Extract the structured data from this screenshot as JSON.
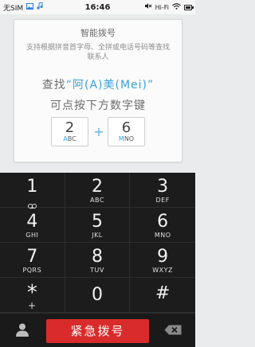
{
  "status_bar": {
    "carrier": "无SIM",
    "time": "16:46",
    "wifi_label": "Hi-Fi",
    "icons": [
      "image-icon",
      "music-icon",
      "mute-icon",
      "wifi-icon",
      "battery-icon"
    ]
  },
  "hint_card": {
    "title": "智能拨号",
    "description": "支持根据拼音首字母、全拼或电话号码等查找联系人",
    "example_prefix": "查找",
    "example_quote_open": "“",
    "example_name": "阿(A)美(Mei)",
    "example_quote_close": "”",
    "example_line2": "可点按下方数字键",
    "example_keys": [
      {
        "digit": "2",
        "letter_hl": "A",
        "letter_rest": "BC"
      },
      {
        "digit": "6",
        "letter_hl": "M",
        "letter_rest": "NO"
      }
    ],
    "plus": "+"
  },
  "keypad": [
    {
      "digit": "1",
      "letters": "",
      "icon": "voicemail-icon"
    },
    {
      "digit": "2",
      "letters": "ABC"
    },
    {
      "digit": "3",
      "letters": "DEF"
    },
    {
      "digit": "4",
      "letters": "GHI"
    },
    {
      "digit": "5",
      "letters": "JKL"
    },
    {
      "digit": "6",
      "letters": "MNO"
    },
    {
      "digit": "7",
      "letters": "PQRS"
    },
    {
      "digit": "8",
      "letters": "TUV"
    },
    {
      "digit": "9",
      "letters": "WXYZ"
    },
    {
      "digit": "*",
      "letters": "+"
    },
    {
      "digit": "0",
      "letters": ""
    },
    {
      "digit": "#",
      "letters": ""
    }
  ],
  "bottom_bar": {
    "emergency_label": "紧急拨号",
    "contact_icon": "contact-icon",
    "delete_icon": "backspace-icon"
  },
  "colors": {
    "accent": "#3aa0dd",
    "emergency": "#d92b2b",
    "keypad_bg": "#1c1c1c"
  }
}
